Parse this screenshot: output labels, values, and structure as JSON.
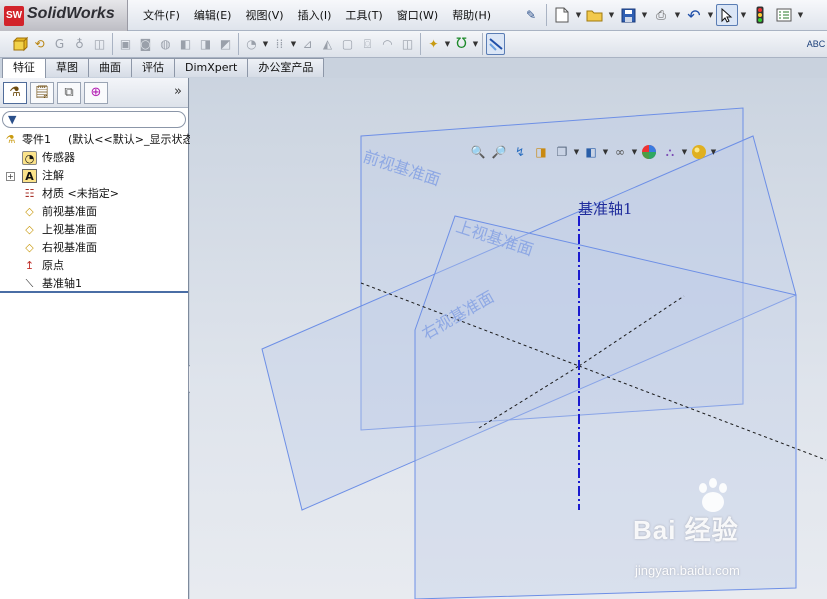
{
  "app": {
    "logo_text": "SolidWorks",
    "logo_badge": "SW"
  },
  "menus": [
    "文件(F)",
    "编辑(E)",
    "视图(V)",
    "插入(I)",
    "工具(T)",
    "窗口(W)",
    "帮助(H)"
  ],
  "tabs": [
    "特征",
    "草图",
    "曲面",
    "评估",
    "DimXpert",
    "办公室产品"
  ],
  "active_tab": "特征",
  "toolbar_right_label": "ABC",
  "tree": {
    "root": {
      "name": "零件1",
      "config": "(默认<<默认>_显示状态"
    },
    "items": [
      {
        "label": "传感器",
        "icon": "sensor-icon",
        "expandable": false
      },
      {
        "label": "注解",
        "icon": "annotation-icon",
        "expandable": true
      },
      {
        "label": "材质 <未指定>",
        "icon": "material-icon",
        "expandable": false
      },
      {
        "label": "前视基准面",
        "icon": "plane-icon",
        "expandable": false
      },
      {
        "label": "上视基准面",
        "icon": "plane-icon",
        "expandable": false
      },
      {
        "label": "右视基准面",
        "icon": "plane-icon",
        "expandable": false
      },
      {
        "label": "原点",
        "icon": "origin-icon",
        "expandable": false
      },
      {
        "label": "基准轴1",
        "icon": "axis-icon",
        "expandable": false
      }
    ]
  },
  "viewport": {
    "planes": {
      "front": "前视基准面",
      "top": "上视基准面",
      "right": "右视基准面"
    },
    "axis_label": "基准轴1",
    "colors": {
      "plane_edge": "#6d8fe6",
      "plane_fill": "#c3cde6",
      "axis": "#1a1acf",
      "hidden_line": "#1a1a1a"
    }
  },
  "watermark": {
    "main": "Bai  经验",
    "url": "jingyan.baidu.com"
  }
}
